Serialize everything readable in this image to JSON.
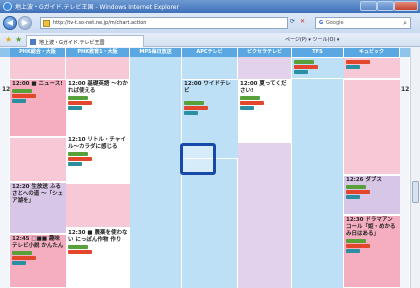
{
  "window": {
    "title": "地上波・Gガイド.テレビ王国 - Windows Internet Explorer"
  },
  "address": {
    "url": "http://tv-t.so-net.ne.jp/m/chart.action"
  },
  "search": {
    "engine_glyph": "G",
    "placeholder": "Google"
  },
  "tab": {
    "label": "地上波・Gガイド.テレビ王国"
  },
  "commandbar": {
    "text": "ページ(P) ▾ ツール(O) ▾"
  },
  "channels": [
    "PHK総合・大阪",
    "PHK教育1・大阪",
    "MPS毎日放送",
    "APCテレビ",
    "ピクセラテレビ",
    "TFS",
    "キュビック"
  ],
  "time": {
    "hour_left": "12",
    "hour_right": "12"
  },
  "programs": {
    "p1": "12:00 ■ ニュース!",
    "p2": "12:00 基礎英語 ～わかれば使える",
    "p3": "12:10 リトル・チャイル～カラダに感じる",
    "p4": "12:20 生放送 ふるさとへの道 ～「シェア湖を」",
    "p5": "12:30 ■ 農薬を使わない にっぽん作物 作り",
    "p6": "12:45 □■■ 趣味 テレビ小説 かんたん",
    "p7": "12:00 ワイドテレビ",
    "p8": "12:00 夏ってください!",
    "p9": "12:26 ダブス",
    "p10": "12:30 ドラマアンコール「姫・めかるみ日はある」"
  },
  "colors": {
    "header": "#5aa7e2",
    "col_pink": "#f7c9d6",
    "col_blue": "#bde0f7",
    "col_lilac": "#e3d2ec",
    "prog_pink": "#f4aec0",
    "prog_lilac": "#d8c6e6",
    "prog_white": "#ffffff",
    "highlight": "#1749a8"
  }
}
